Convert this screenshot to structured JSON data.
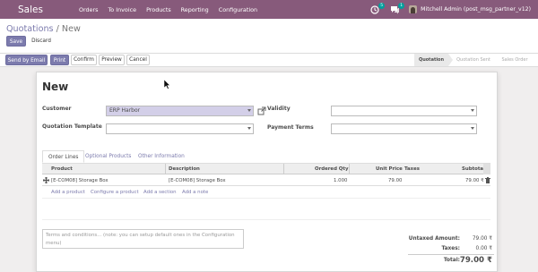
{
  "navbar": {
    "app_name": "Sales",
    "menu": [
      "Orders",
      "To Invoice",
      "Products",
      "Reporting",
      "Configuration"
    ],
    "activity_badge": "5",
    "message_badge": "1",
    "user": "Mitchell Admin (post_msg_partner_v12)"
  },
  "breadcrumb": {
    "parent": "Quotations",
    "separator": "/",
    "current": "New"
  },
  "buttons": {
    "save": "Save",
    "discard": "Discard",
    "send_by_email": "Send by Email",
    "print": "Print",
    "confirm": "Confirm",
    "preview": "Preview",
    "cancel": "Cancel"
  },
  "stages": [
    "Quotation",
    "Quotation Sent",
    "Sales Order"
  ],
  "form": {
    "title": "New",
    "customer_label": "Customer",
    "customer_value": "ERP Harbor",
    "quotation_template_label": "Quotation Template",
    "quotation_template_value": "",
    "validity_label": "Validity",
    "validity_value": "",
    "payment_terms_label": "Payment Terms",
    "payment_terms_value": ""
  },
  "tabs": [
    "Order Lines",
    "Optional Products",
    "Other Information"
  ],
  "table": {
    "headers": [
      "Product",
      "Description",
      "Ordered Qty",
      "Unit Price",
      "Taxes",
      "Subtotal"
    ],
    "rows": [
      {
        "product": "[E-COM08] Storage Box",
        "description": "[E-COM08] Storage Box",
        "qty": "1.000",
        "unit_price": "79.00",
        "taxes": "",
        "subtotal": "79.00 ₹"
      }
    ],
    "actions": [
      "Add a product",
      "Configure a product",
      "Add a section",
      "Add a note"
    ]
  },
  "notes_placeholder": "Terms and conditions... (note: you can setup default ones in the Configuration menu)",
  "totals": {
    "untaxed_label": "Untaxed Amount:",
    "untaxed_value": "79.00 ₹",
    "taxes_label": "Taxes:",
    "taxes_value": "0.00 ₹",
    "total_label": "Total:",
    "total_value": "79.00 ₹"
  },
  "colors": {
    "brand": "#875a7b",
    "accent": "#7c7bad",
    "selected_field": "#d3cfe8"
  }
}
